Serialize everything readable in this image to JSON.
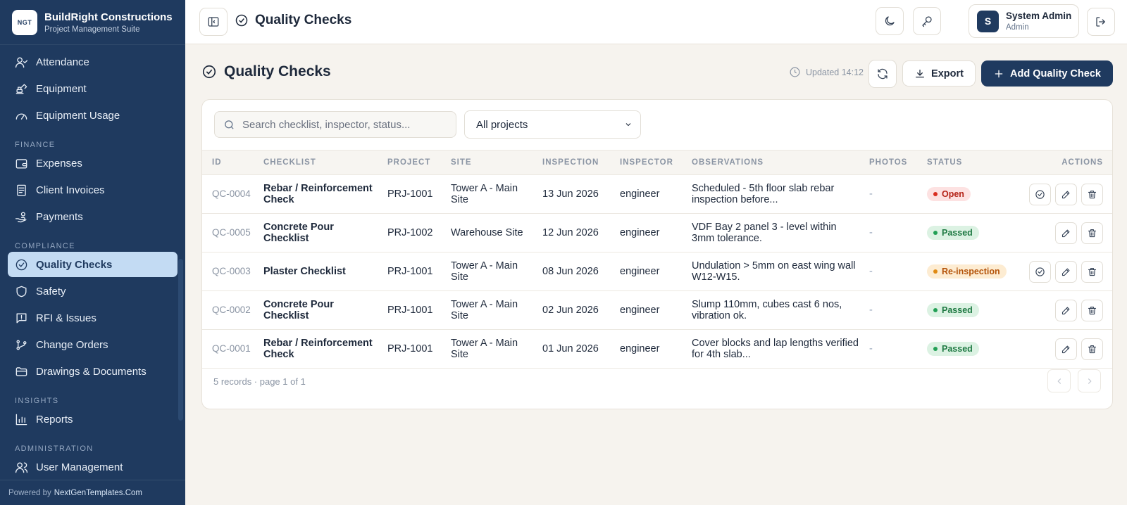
{
  "brand": {
    "logo_text": "NGT",
    "title": "BuildRight Constructions",
    "subtitle": "Project Management Suite"
  },
  "sidebar": {
    "items_top": [
      {
        "label": "Attendance",
        "icon": "user-check-icon"
      },
      {
        "label": "Equipment",
        "icon": "excavator-icon"
      },
      {
        "label": "Equipment Usage",
        "icon": "gauge-icon"
      }
    ],
    "finance_title": "FINANCE",
    "finance": [
      {
        "label": "Expenses",
        "icon": "wallet-icon"
      },
      {
        "label": "Client Invoices",
        "icon": "receipt-icon"
      },
      {
        "label": "Payments",
        "icon": "hand-coins-icon"
      }
    ],
    "compliance_title": "COMPLIANCE",
    "compliance": [
      {
        "label": "Quality Checks",
        "icon": "check-circle-icon",
        "active": true
      },
      {
        "label": "Safety",
        "icon": "shield-icon"
      },
      {
        "label": "RFI & Issues",
        "icon": "message-alert-icon"
      },
      {
        "label": "Change Orders",
        "icon": "git-branch-icon"
      },
      {
        "label": "Drawings & Documents",
        "icon": "folder-open-icon"
      }
    ],
    "insights_title": "INSIGHTS",
    "insights": [
      {
        "label": "Reports",
        "icon": "bar-chart-icon"
      }
    ],
    "admin_title": "ADMINISTRATION",
    "admin": [
      {
        "label": "User Management",
        "icon": "users-icon"
      }
    ],
    "powered_by": "Powered by",
    "powered_link": "NextGenTemplates.Com"
  },
  "topbar": {
    "title": "Quality Checks",
    "user_initial": "S",
    "user_name": "System Admin",
    "user_role": "Admin"
  },
  "page": {
    "title": "Quality Checks",
    "updated": "Updated 14:12",
    "export_label": "Export",
    "add_label": "Add Quality Check"
  },
  "filters": {
    "search_placeholder": "Search checklist, inspector, status...",
    "project_select": "All projects"
  },
  "table": {
    "columns": [
      "ID",
      "CHECKLIST",
      "PROJECT",
      "SITE",
      "INSPECTION",
      "INSPECTOR",
      "OBSERVATIONS",
      "PHOTOS",
      "STATUS",
      "ACTIONS"
    ],
    "rows": [
      {
        "id": "QC-0004",
        "checklist": "Rebar / Reinforcement Check",
        "project": "PRJ-1001",
        "site": "Tower A - Main Site",
        "inspection": "13 Jun 2026",
        "inspector": "engineer",
        "observations": "Scheduled - 5th floor slab rebar inspection before...",
        "photos": "-",
        "status": "Open",
        "status_kind": "open",
        "can_approve": true
      },
      {
        "id": "QC-0005",
        "checklist": "Concrete Pour Checklist",
        "project": "PRJ-1002",
        "site": "Warehouse Site",
        "inspection": "12 Jun 2026",
        "inspector": "engineer",
        "observations": "VDF Bay 2 panel 3 - level within 3mm tolerance.",
        "photos": "-",
        "status": "Passed",
        "status_kind": "passed",
        "can_approve": false
      },
      {
        "id": "QC-0003",
        "checklist": "Plaster Checklist",
        "project": "PRJ-1001",
        "site": "Tower A - Main Site",
        "inspection": "08 Jun 2026",
        "inspector": "engineer",
        "observations": "Undulation > 5mm on east wing wall W12-W15.",
        "photos": "-",
        "status": "Re-inspection",
        "status_kind": "reinsp",
        "can_approve": true
      },
      {
        "id": "QC-0002",
        "checklist": "Concrete Pour Checklist",
        "project": "PRJ-1001",
        "site": "Tower A - Main Site",
        "inspection": "02 Jun 2026",
        "inspector": "engineer",
        "observations": "Slump 110mm, cubes cast 6 nos, vibration ok.",
        "photos": "-",
        "status": "Passed",
        "status_kind": "passed",
        "can_approve": false
      },
      {
        "id": "QC-0001",
        "checklist": "Rebar / Reinforcement Check",
        "project": "PRJ-1001",
        "site": "Tower A - Main Site",
        "inspection": "01 Jun 2026",
        "inspector": "engineer",
        "observations": "Cover blocks and lap lengths verified for 4th slab...",
        "photos": "-",
        "status": "Passed",
        "status_kind": "passed",
        "can_approve": false
      }
    ],
    "footer": "5 records · page 1 of 1"
  }
}
